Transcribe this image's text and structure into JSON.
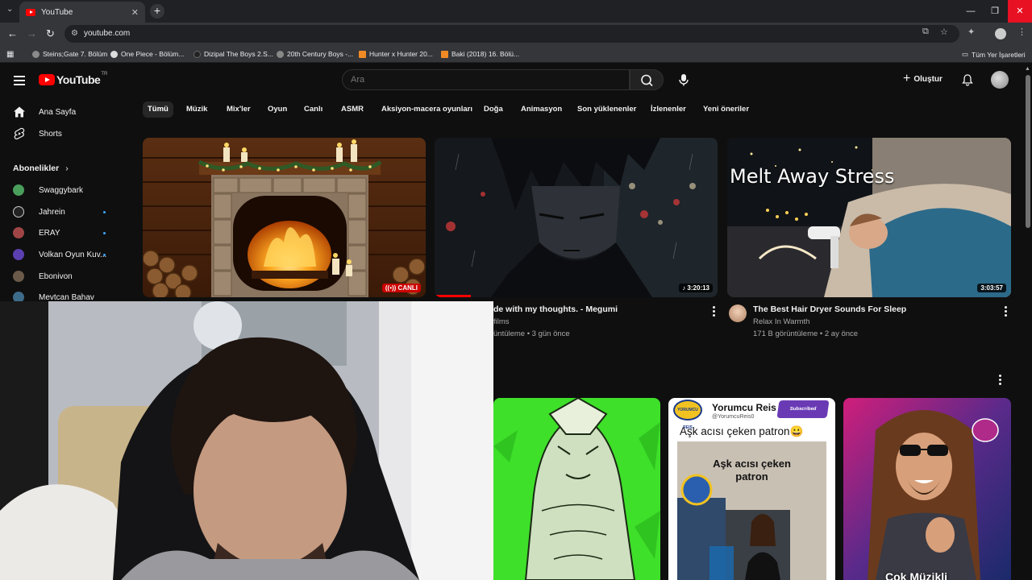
{
  "browser": {
    "tab_title": "YouTube",
    "tab_close": "✕",
    "new_tab": "+",
    "url": "youtube.com",
    "bookmarks": [
      {
        "label": "Steins;Gate 7. Bölüm"
      },
      {
        "label": "One Piece - Bölüm..."
      },
      {
        "label": "Dizipal The Boys 2.S..."
      },
      {
        "label": "20th Century Boys -..."
      },
      {
        "label": "Hunter x Hunter 20..."
      },
      {
        "label": "Baki (2018) 16. Bölü..."
      }
    ],
    "all_bookmarks": "Tüm Yer İşaretleri"
  },
  "header": {
    "logo_text": "YouTube",
    "logo_country": "TR",
    "search_placeholder": "Ara",
    "create_label": "Oluştur"
  },
  "sidebar": {
    "home": "Ana Sayfa",
    "shorts": "Shorts",
    "subscriptions_title": "Abonelikler",
    "subscriptions": [
      {
        "name": "Swaggybark",
        "color": "#4a9e5c",
        "live": false
      },
      {
        "name": "Jahrein",
        "color": "#222222",
        "live": true
      },
      {
        "name": "ERAY",
        "color": "#a04545",
        "live": true
      },
      {
        "name": "Volkan Oyun Kuv...",
        "color": "#5b3fb0",
        "live": true
      },
      {
        "name": "Ebonivon",
        "color": "#6b5a4a",
        "live": false
      },
      {
        "name": "Mevtcan Bahav",
        "color": "#3d6b8a",
        "live": false
      }
    ]
  },
  "chips": [
    "Tümü",
    "Müzik",
    "Mix'ler",
    "Oyun",
    "Canlı",
    "ASMR",
    "Aksiyon-macera oyunları",
    "Doğa",
    "Animasyon",
    "Son yüklenenler",
    "İzlenenler",
    "Yeni öneriler"
  ],
  "videos": [
    {
      "badge": "CANLI",
      "badge_color": "#cc0000"
    },
    {
      "badge": "♪ 3:20:13",
      "title": "de with my thoughts. - Megumi",
      "channel": "films",
      "meta": "üntüleme • 3 gün önce"
    },
    {
      "badge": "3:03:57",
      "overlay": "Melt Away Stress",
      "title": "The Best Hair Dryer Sounds For Sleep",
      "channel": "Relax In Warmth",
      "meta": "171 B görüntüleme • 2 ay önce"
    }
  ],
  "shorts_row": {
    "card2_channel": "Yorumcu Reis",
    "card2_handle": "@YorumcuReis0",
    "card2_title": "Aşk acısı çeken patron😀",
    "card2_caption": "Aşk acısı çeken patron",
    "card2_subscribed": "Subscribed",
    "card2_logo": "YORUMCU REIS",
    "card3_caption": "Çok Müzikli"
  }
}
